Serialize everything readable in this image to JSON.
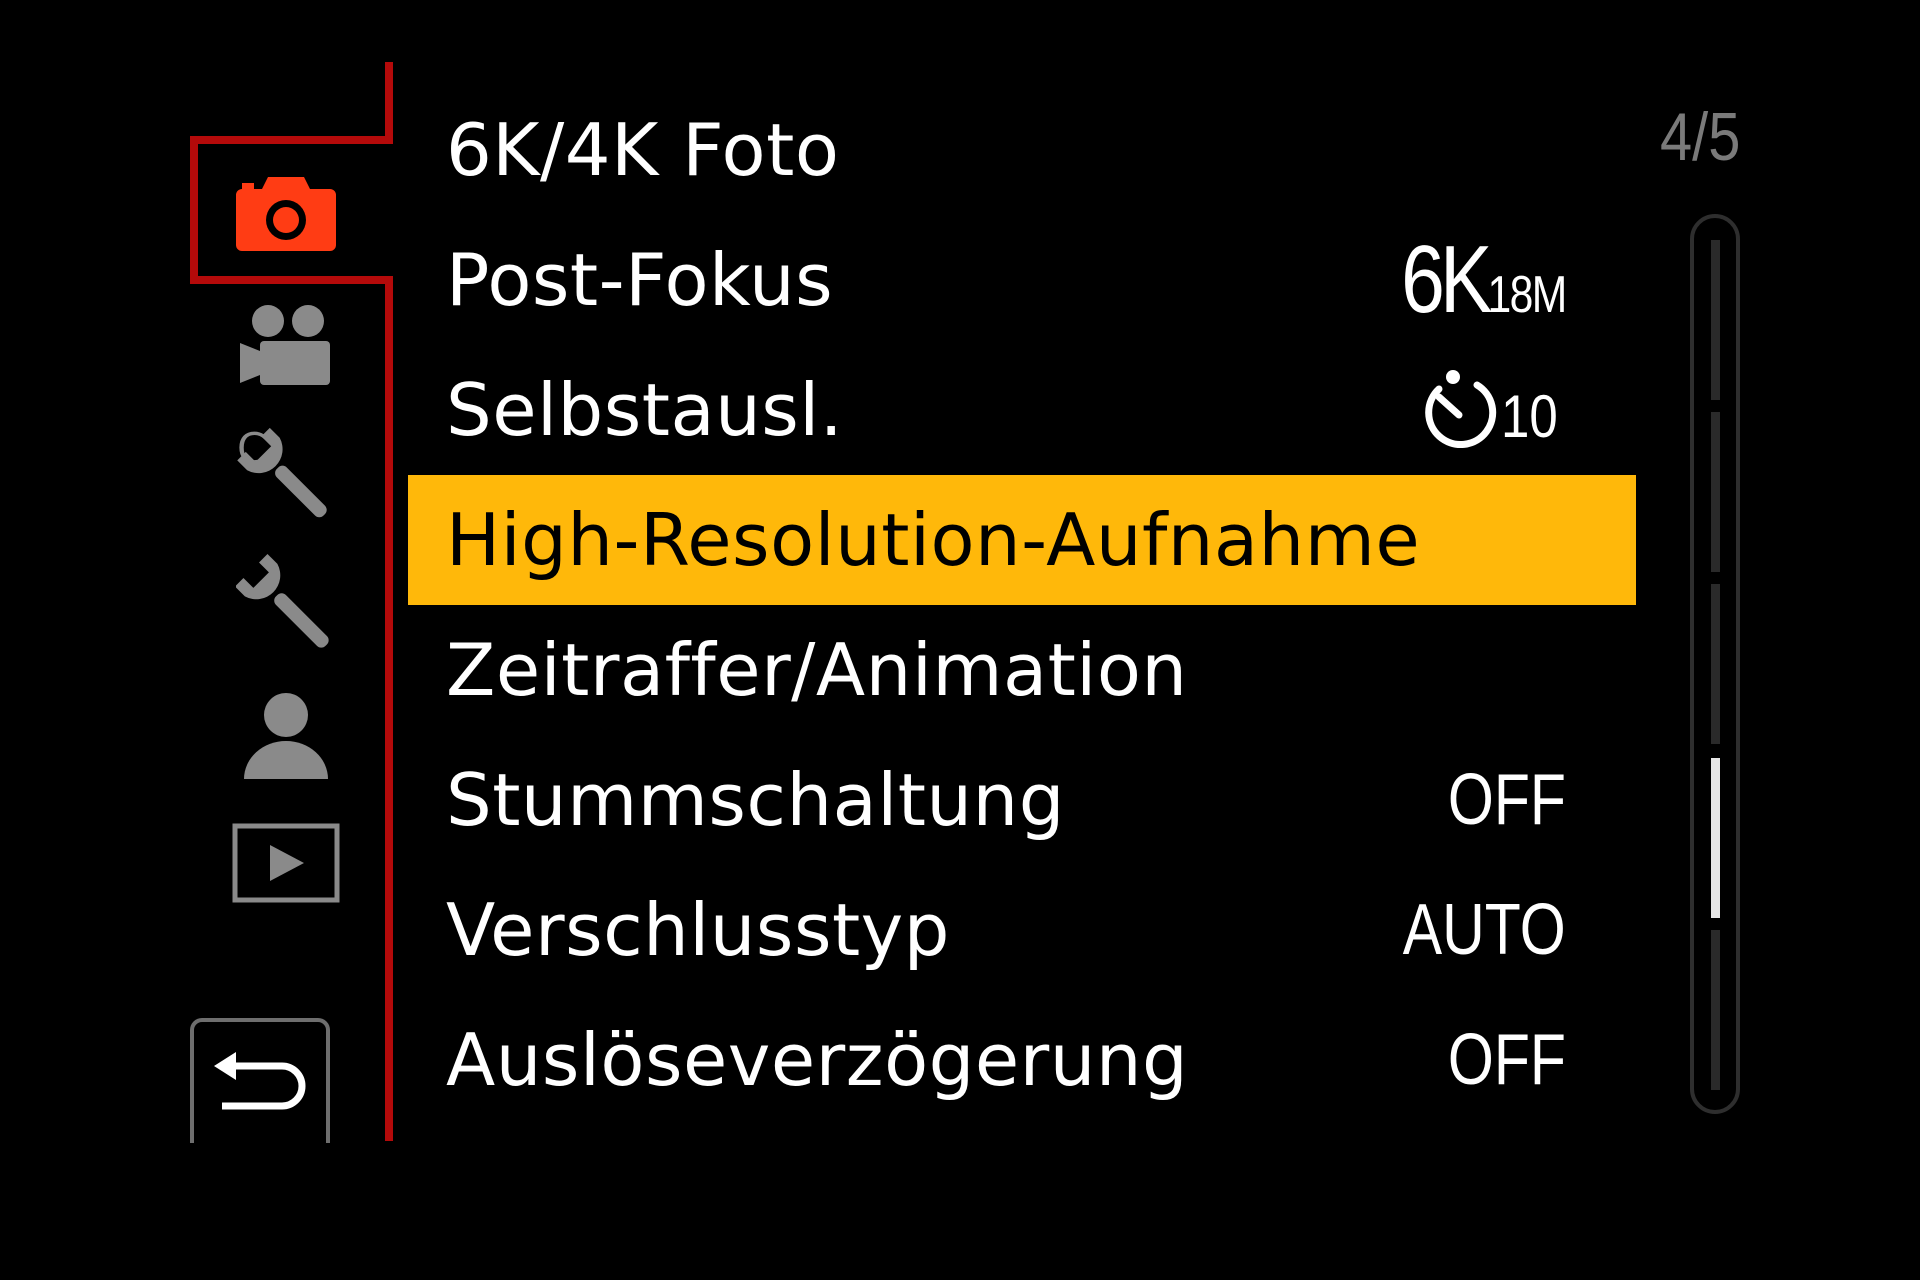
{
  "sidebar": {
    "icons": [
      {
        "name": "camera-icon",
        "color": "#ff3c14",
        "active": true
      },
      {
        "name": "video-camera-icon",
        "color": "#8a8a8a"
      },
      {
        "name": "custom-wrench-icon",
        "color": "#8a8a8a",
        "letter": "C"
      },
      {
        "name": "wrench-icon",
        "color": "#8a8a8a"
      },
      {
        "name": "person-icon",
        "color": "#8a8a8a"
      },
      {
        "name": "playback-icon",
        "color": "#8a8a8a"
      }
    ],
    "back_icon": "return-arrow-icon"
  },
  "page_indicator": "4/5",
  "menu": {
    "items": [
      {
        "label": "6K/4K Foto",
        "value": ""
      },
      {
        "label": "Post-Fokus",
        "value_main": "6K",
        "value_sub": "18M"
      },
      {
        "label": "Selbstausl.",
        "value_icon": "self-timer-icon",
        "value": "10"
      },
      {
        "label": "High-Resolution-Aufnahme",
        "value": "",
        "selected": true
      },
      {
        "label": "Zeitraffer/Animation",
        "value": ""
      },
      {
        "label": "Stummschaltung",
        "value": "OFF"
      },
      {
        "label": "Verschlusstyp",
        "value": "AUTO"
      },
      {
        "label": "Auslöseverzögerung",
        "value": "OFF"
      }
    ]
  },
  "scrollbar": {
    "pages": 5,
    "current_page": 4
  },
  "colors": {
    "accent_selected": "#ffb80a",
    "frame_red": "#b40a0a",
    "active_icon": "#ff3c14",
    "inactive_icon": "#8a8a8a"
  }
}
